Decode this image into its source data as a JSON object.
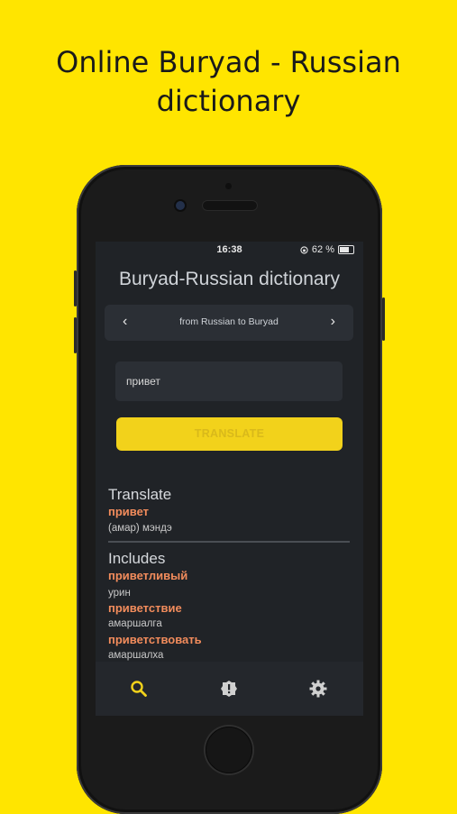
{
  "headline": {
    "line1": "Online Buryad - Russian",
    "line2": "dictionary"
  },
  "status_bar": {
    "time": "16:38",
    "battery": "62 %"
  },
  "app": {
    "title": "Buryad-Russian dictionary",
    "direction": {
      "label": "from Russian to Buryad",
      "prev_icon": "chevron-left-icon",
      "next_icon": "chevron-right-icon"
    },
    "search": {
      "value": "привет",
      "placeholder": ""
    },
    "translate_button": "TRANSLATE"
  },
  "results": {
    "translate_heading": "Translate",
    "main_entry": {
      "word": "привет",
      "translation": "(амар) мэндэ"
    },
    "includes_heading": "Includes",
    "includes": [
      {
        "word": "приветливый",
        "translation": "урин"
      },
      {
        "word": "приветствие",
        "translation": "амаршалга"
      },
      {
        "word": "приветствовать",
        "translation": "амаршалха"
      }
    ]
  },
  "navbar": {
    "items": [
      {
        "icon": "search-icon",
        "active": true
      },
      {
        "icon": "alert-icon",
        "active": false
      },
      {
        "icon": "gear-icon",
        "active": false
      }
    ],
    "active_color": "#F2D21B",
    "inactive_color": "#d0d0d0"
  },
  "colors": {
    "background": "#FFE500",
    "accent": "#F2D21B",
    "word": "#F28C5C",
    "screen_bg": "#202327"
  }
}
